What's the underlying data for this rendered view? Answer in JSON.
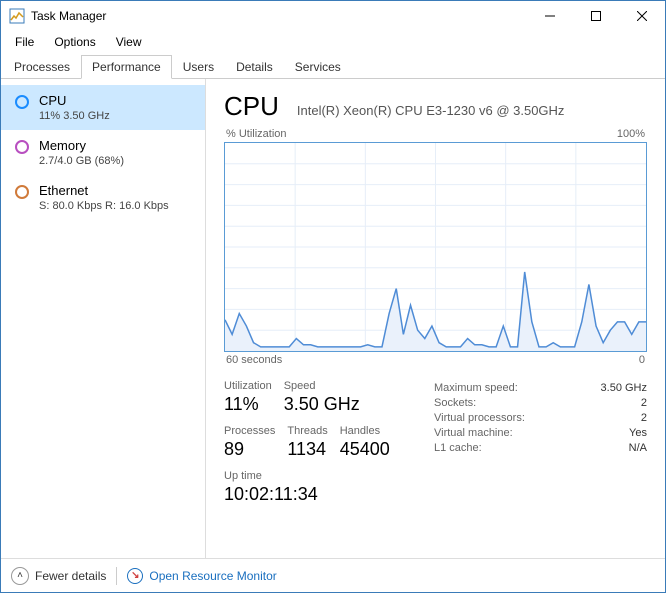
{
  "window": {
    "title": "Task Manager"
  },
  "menu": {
    "file": "File",
    "options": "Options",
    "view": "View"
  },
  "tabs": [
    "Processes",
    "Performance",
    "Users",
    "Details",
    "Services"
  ],
  "active_tab": 1,
  "sidebar": {
    "items": [
      {
        "name": "CPU",
        "sub": "11%  3.50 GHz",
        "color": "#1a8cff"
      },
      {
        "name": "Memory",
        "sub": "2.7/4.0 GB (68%)",
        "color": "#b84fc0"
      },
      {
        "name": "Ethernet",
        "sub": "S: 80.0 Kbps  R: 16.0 Kbps",
        "color": "#d07a3a"
      }
    ],
    "selected": 0
  },
  "header": {
    "title": "CPU",
    "model": "Intel(R) Xeon(R) CPU E3-1230 v6 @ 3.50GHz"
  },
  "chart_labels": {
    "tl": "% Utilization",
    "tr": "100%",
    "bl": "60 seconds",
    "br": "0"
  },
  "chart_data": {
    "type": "line",
    "title": "CPU % Utilization",
    "xlabel": "60 seconds",
    "ylabel": "% Utilization",
    "ylim": [
      0,
      100
    ],
    "x_range": "60 seconds → 0",
    "series": [
      {
        "name": "CPU",
        "color": "#4f8cd6",
        "values": [
          15,
          8,
          18,
          12,
          4,
          2,
          2,
          2,
          2,
          2,
          6,
          3,
          3,
          2,
          2,
          2,
          2,
          2,
          2,
          2,
          3,
          2,
          2,
          18,
          30,
          8,
          22,
          10,
          6,
          12,
          4,
          2,
          2,
          2,
          6,
          3,
          3,
          2,
          2,
          12,
          2,
          2,
          38,
          14,
          2,
          2,
          4,
          2,
          2,
          2,
          14,
          32,
          12,
          4,
          10,
          14,
          14,
          8,
          14,
          14
        ]
      }
    ]
  },
  "stats": {
    "utilization_label": "Utilization",
    "utilization": "11%",
    "speed_label": "Speed",
    "speed": "3.50 GHz",
    "processes_label": "Processes",
    "processes": "89",
    "threads_label": "Threads",
    "threads": "1134",
    "handles_label": "Handles",
    "handles": "45400",
    "uptime_label": "Up time",
    "uptime": "10:02:11:34"
  },
  "details": {
    "max_speed_k": "Maximum speed:",
    "max_speed_v": "3.50 GHz",
    "sockets_k": "Sockets:",
    "sockets_v": "2",
    "vprocs_k": "Virtual processors:",
    "vprocs_v": "2",
    "vm_k": "Virtual machine:",
    "vm_v": "Yes",
    "l1_k": "L1 cache:",
    "l1_v": "N/A"
  },
  "footer": {
    "fewer": "Fewer details",
    "orm": "Open Resource Monitor"
  }
}
